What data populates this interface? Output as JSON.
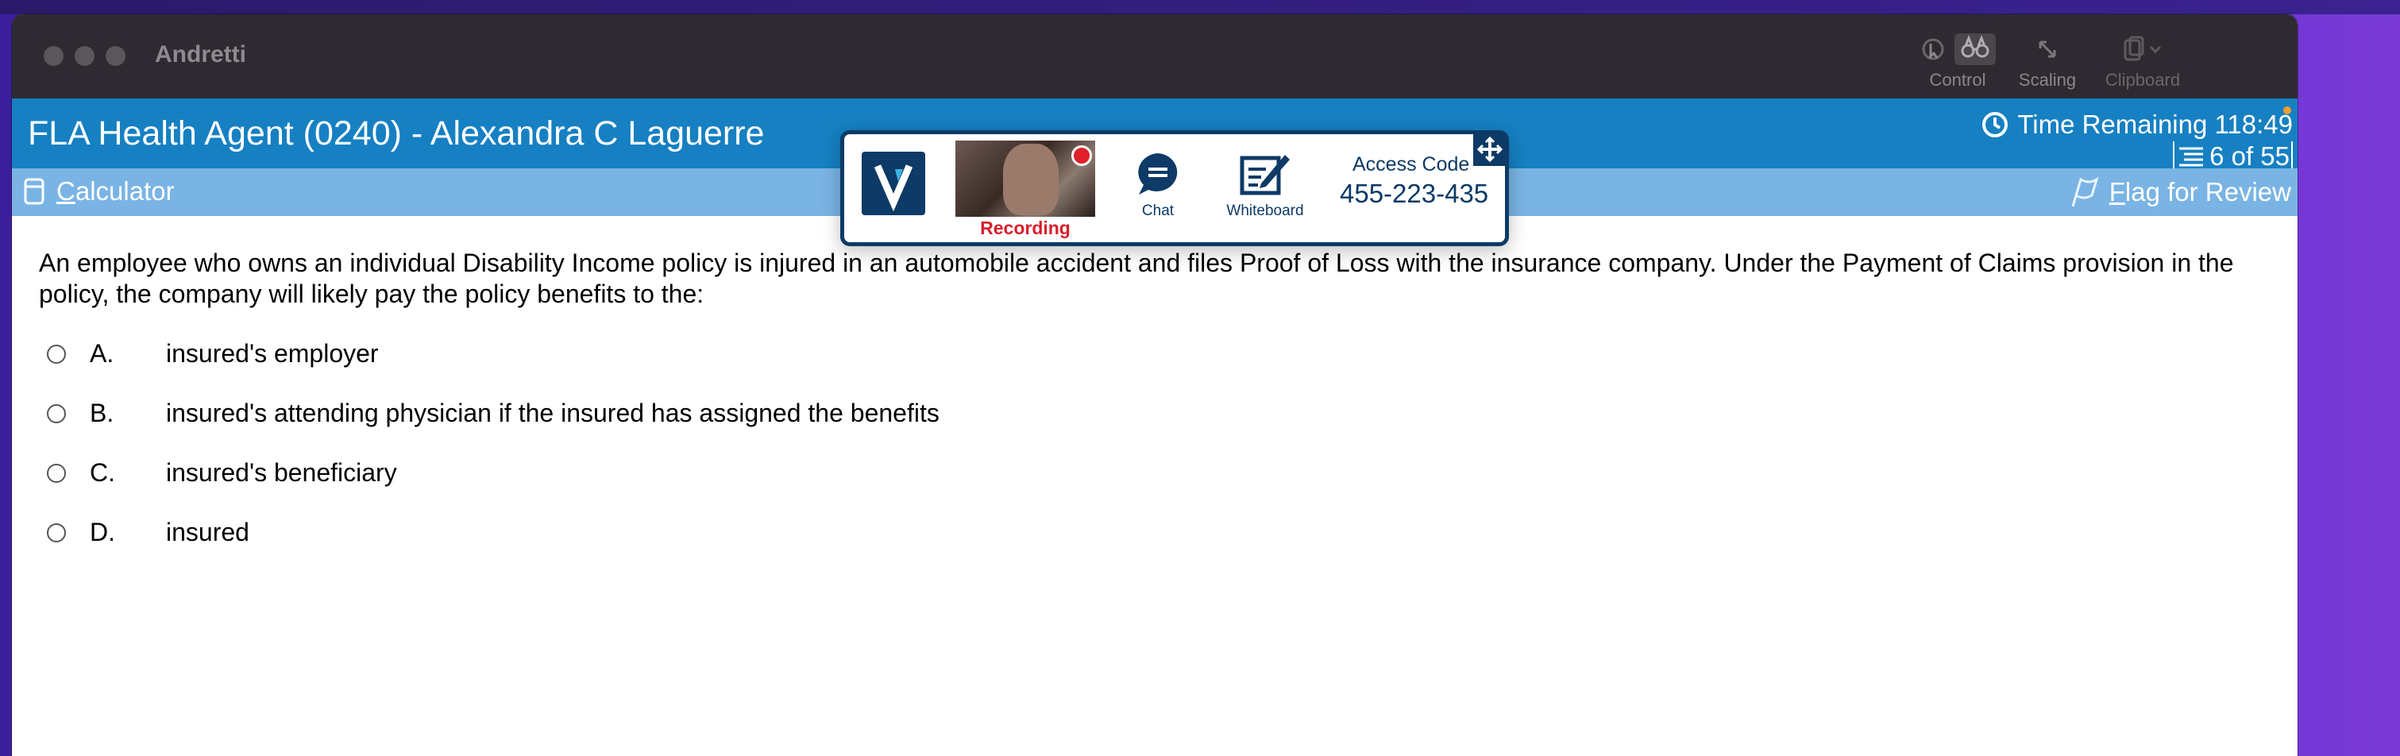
{
  "window": {
    "app_title": "Andretti"
  },
  "titlebar_tools": {
    "control": {
      "label": "Control",
      "icon": "binoculars-icon"
    },
    "scaling": {
      "label": "Scaling",
      "icon": "scale-arrows-icon"
    },
    "clipboard": {
      "label": "Clipboard",
      "icon": "clipboard-icon"
    }
  },
  "exam": {
    "title": "FLA Health Agent (0240) - Alexandra C Laguerre",
    "time_remaining": "Time Remaining 118:49",
    "progress": "6 of 55"
  },
  "toolbar": {
    "calculator_label": "Calculator",
    "flag_label": "Flag for Review"
  },
  "proctor": {
    "recording_label": "Recording",
    "chat_label": "Chat",
    "whiteboard_label": "Whiteboard",
    "access_code_label": "Access Code",
    "access_code": "455-223-435"
  },
  "question": {
    "text": "An employee who owns an individual Disability Income policy is injured in an automobile accident and files Proof of Loss with the insurance company. Under the Payment of Claims provision in the policy, the company will likely pay the policy benefits to the:",
    "options": [
      {
        "letter": "A.",
        "text": "insured's employer"
      },
      {
        "letter": "B.",
        "text": "insured's attending physician if the insured has assigned the benefits"
      },
      {
        "letter": "C.",
        "text": "insured's beneficiary"
      },
      {
        "letter": "D.",
        "text": "insured"
      }
    ]
  },
  "colors": {
    "header_blue": "#1680c2",
    "toolbar_blue": "#7ab4e4",
    "proctor_navy": "#0d3a66",
    "recording_red": "#d91e2a"
  }
}
